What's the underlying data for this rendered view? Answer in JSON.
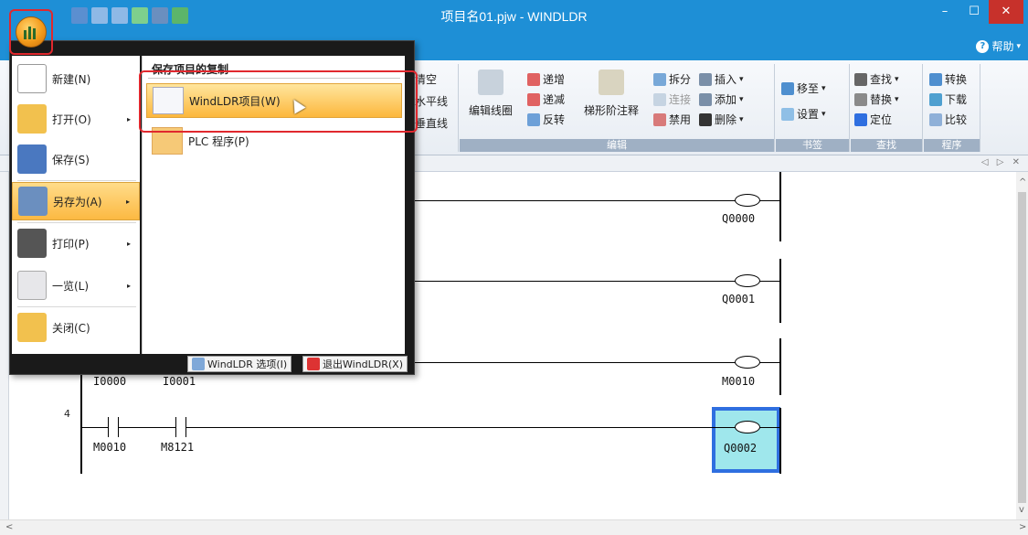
{
  "window": {
    "title": "项目名01.pjw - WINDLDR",
    "min": "–",
    "max": "☐",
    "close": "✕"
  },
  "ribbon": {
    "help": "帮助",
    "help_icon": "?",
    "groups": {
      "edit_label": "编辑",
      "bookmark_label": "书签",
      "find_label": "查找",
      "program_label": "程序"
    },
    "partial": {
      "clear": "清空",
      "hline": "水平线",
      "vline": "垂直线"
    },
    "edit_coil": "编辑线圈",
    "inc": "递增",
    "dec": "递减",
    "invert": "反转",
    "rung_comment": "梯形阶注释",
    "split": "拆分",
    "connect": "连接",
    "disable": "禁用",
    "insert": "插入",
    "add": "添加",
    "delete": "删除",
    "goto": "移至",
    "set": "设置",
    "find": "查找",
    "replace": "替换",
    "locate": "定位",
    "convert": "转换",
    "download": "下载",
    "compare": "比较"
  },
  "doc_nav": "◁ ▷ ✕",
  "app_menu": {
    "items": [
      {
        "label": "新建(N)"
      },
      {
        "label": "打开(O)"
      },
      {
        "label": "保存(S)"
      },
      {
        "label": "另存为(A)"
      },
      {
        "label": "打印(P)"
      },
      {
        "label": "一览(L)"
      },
      {
        "label": "关闭(C)"
      }
    ],
    "submenu": {
      "heading": "保存项目的复制",
      "items": [
        {
          "label": "WindLDR项目(W)"
        },
        {
          "label": "PLC 程序(P)"
        }
      ]
    },
    "footer": {
      "options": "WindLDR 选项(I)",
      "exit": "退出WindLDR(X)"
    }
  },
  "ladder": {
    "coils": [
      "Q0000",
      "Q0001",
      "M0010",
      "Q0002"
    ],
    "rung4_number": "4",
    "rung3_contacts": [
      "I0000",
      "I0001"
    ],
    "rung4_contacts": [
      "M0010",
      "M8121"
    ]
  },
  "colors": {
    "titlebar": "#1e8fd6",
    "selection": "#2f6fe0",
    "highlight": "#fcb942",
    "annotation": "#e0282e"
  }
}
